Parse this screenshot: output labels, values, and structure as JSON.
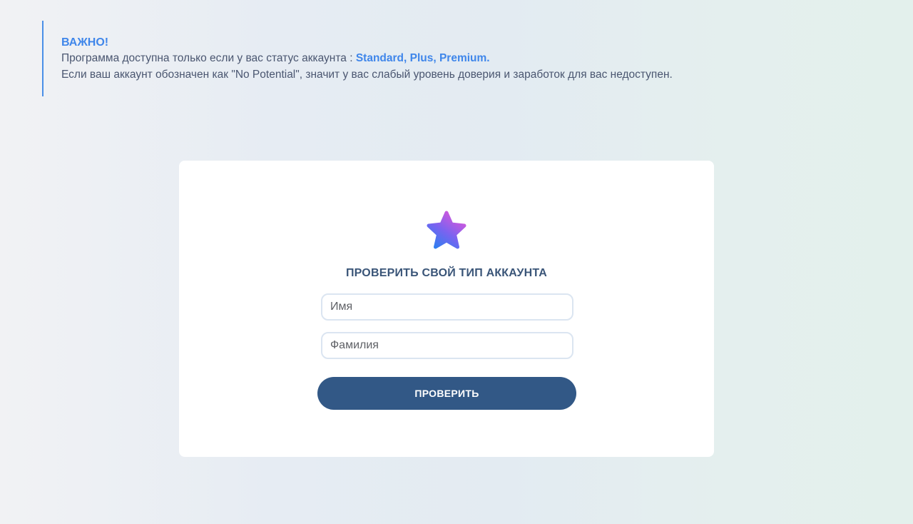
{
  "notice": {
    "title": "ВАЖНО!",
    "line1_prefix": "Программа доступна только если у вас статус аккаунта : ",
    "line1_highlight": "Standard, Plus, Premium.",
    "line2": "Если ваш аккаунт обозначен как \"No Potential\", значит у вас слабый уровень доверия и заработок для вас недоступен.",
    "accent_color": "#3f86ea"
  },
  "card": {
    "logo_icon": "gradient-star-icon",
    "title": "ПРОВЕРИТЬ СВОЙ ТИП АККАУНТА",
    "first_name": {
      "placeholder": "Имя",
      "value": ""
    },
    "last_name": {
      "placeholder": "Фамилия",
      "value": ""
    },
    "submit_label": "ПРОВЕРИТЬ",
    "button_color": "#325886"
  }
}
